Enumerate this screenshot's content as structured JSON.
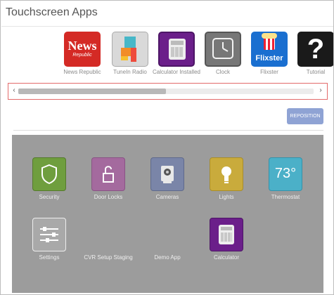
{
  "title": "Touchscreen Apps",
  "strip_apps": [
    {
      "label": "News Republic",
      "icon": "news-republic-icon",
      "icon_text": "News",
      "icon_sub": "Republic"
    },
    {
      "label": "TuneIn Radio",
      "icon": "tunein-icon"
    },
    {
      "label": "Calculator Installed",
      "icon": "calculator-icon"
    },
    {
      "label": "Clock",
      "icon": "clock-icon"
    },
    {
      "label": "Flixster",
      "icon": "flixster-icon",
      "icon_text": "Flixster"
    },
    {
      "label": "Tutorial",
      "icon": "tutorial-icon",
      "icon_text": "?"
    }
  ],
  "scrollbar": {
    "left_arrow": "‹",
    "right_arrow": "›",
    "position_fraction": 0.0,
    "visible_fraction": 0.5
  },
  "reposition_label": "REPOSITION",
  "tiles": [
    {
      "label": "Security",
      "icon": "shield-icon",
      "color": "#6f9e3e"
    },
    {
      "label": "Door Locks",
      "icon": "unlock-icon",
      "color": "#a46a9e"
    },
    {
      "label": "Cameras",
      "icon": "camera-icon",
      "color": "#7a85a8"
    },
    {
      "label": "Lights",
      "icon": "lightbulb-icon",
      "color": "#c9ab3c"
    },
    {
      "label": "Thermostat",
      "icon": "thermostat-icon",
      "color": "#4bb0c8",
      "value": "73°"
    },
    {
      "label": "Settings",
      "icon": "sliders-icon",
      "color": "#a9a9a9"
    },
    {
      "label": "CVR Setup Staging",
      "icon": "",
      "color": ""
    },
    {
      "label": "Demo App",
      "icon": "",
      "color": ""
    },
    {
      "label": "Calculator",
      "icon": "calculator-icon",
      "color": "#6b1f8a"
    }
  ]
}
